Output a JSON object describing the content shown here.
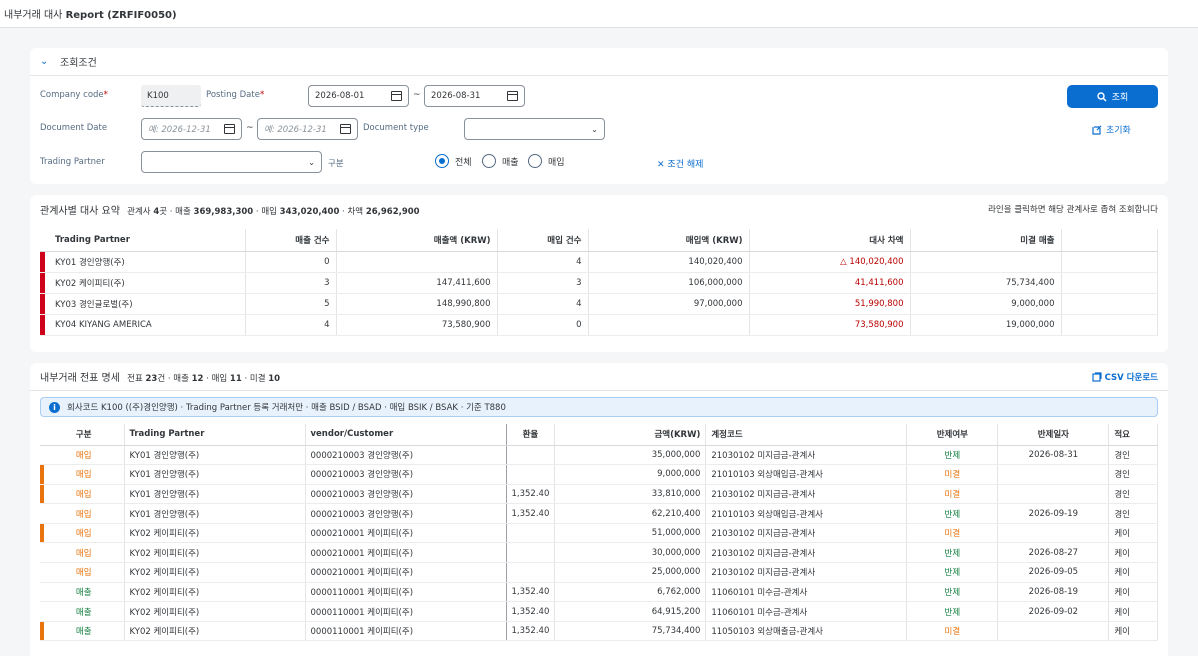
{
  "app": {
    "title_plain": "내부거래 대사",
    "title_bold": "Report (ZRFIF0050)"
  },
  "criteria": {
    "header": "조회조건",
    "company_code_label": "Company code",
    "company_code_value": "K100",
    "posting_date_label": "Posting Date",
    "posting_from": "2026-08-01",
    "posting_to": "2026-08-31",
    "document_date_label": "Document Date",
    "doc_from_ph": "예: 2026-12-31",
    "doc_to_ph": "예: 2026-12-31",
    "document_type_label": "Document type",
    "trading_partner_label": "Trading Partner",
    "division_label": "구분",
    "radio_all": "전체",
    "radio_sales": "매출",
    "radio_purchase": "매입",
    "clear_label": "조건 해제",
    "search_label": "조회",
    "reset_label": "초기화",
    "tilde": "~",
    "req": "*"
  },
  "summary": {
    "title": "관계사별 대사 요약",
    "meta_parts": [
      "관계사 ",
      "4",
      "곳 · 매출 ",
      "369,983,300",
      " · 매입 ",
      "343,020,400",
      " · 차액 ",
      "26,962,900"
    ],
    "hint": "라인을 클릭하면 해당 관계사로 좁혀 조회합니다",
    "columns": [
      "Trading Partner",
      "매출 건수",
      "매출액 (KRW)",
      "매입 건수",
      "매입액 (KRW)",
      "대사 차액",
      "미결 매출"
    ],
    "rows": [
      {
        "partner": "KY01 경인양행(주)",
        "sales_cnt": "0",
        "sales_amt": "",
        "pur_cnt": "4",
        "pur_amt": "140,020,400",
        "diff": "△ 140,020,400",
        "open": ""
      },
      {
        "partner": "KY02 케이피티(주)",
        "sales_cnt": "3",
        "sales_amt": "147,411,600",
        "pur_cnt": "3",
        "pur_amt": "106,000,000",
        "diff": "41,411,600",
        "open": "75,734,400"
      },
      {
        "partner": "KY03 경인글로벌(주)",
        "sales_cnt": "5",
        "sales_amt": "148,990,800",
        "pur_cnt": "4",
        "pur_amt": "97,000,000",
        "diff": "51,990,800",
        "open": "9,000,000"
      },
      {
        "partner": "KY04 KIYANG AMERICA",
        "sales_cnt": "4",
        "sales_amt": "73,580,900",
        "pur_cnt": "0",
        "pur_amt": "",
        "diff": "73,580,900",
        "open": "19,000,000"
      }
    ]
  },
  "details": {
    "title": "내부거래 전표 명세",
    "meta_parts": [
      "전표 ",
      "23",
      "건 · 매출 ",
      "12",
      " · 매입 ",
      "11",
      " · 미결 ",
      "10"
    ],
    "csv_label": "CSV 다운로드",
    "info": "회사코드 K100 ((주)경인양행) · Trading Partner 등록 거래처만 · 매출 BSID / BSAD · 매입 BSIK / BSAK · 기준 T880",
    "columns": [
      "구분",
      "Trading Partner",
      "vendor/Customer",
      "환율",
      "금액(KRW)",
      "계정코드",
      "반제여부",
      "반제일자",
      "적요"
    ],
    "rows": [
      {
        "flag": false,
        "type": "매입",
        "partner": "KY01 경인양행(주)",
        "vc": "0000210003 경인양행(주)",
        "rate": "",
        "amt": "35,000,000",
        "acct": "21030102 미지급금-관계사",
        "cleared": "반제",
        "cdate": "2026-08-31",
        "memo": "경인"
      },
      {
        "flag": true,
        "type": "매입",
        "partner": "KY01 경인양행(주)",
        "vc": "0000210003 경인양행(주)",
        "rate": "",
        "amt": "9,000,000",
        "acct": "21010103 외상매입금-관계사",
        "cleared": "미결",
        "cdate": "",
        "memo": "경인"
      },
      {
        "flag": true,
        "type": "매입",
        "partner": "KY01 경인양행(주)",
        "vc": "0000210003 경인양행(주)",
        "rate": "1,352.40",
        "amt": "33,810,000",
        "acct": "21030102 미지급금-관계사",
        "cleared": "미결",
        "cdate": "",
        "memo": "경인"
      },
      {
        "flag": false,
        "type": "매입",
        "partner": "KY01 경인양행(주)",
        "vc": "0000210003 경인양행(주)",
        "rate": "1,352.40",
        "amt": "62,210,400",
        "acct": "21010103 외상매입금-관계사",
        "cleared": "반제",
        "cdate": "2026-09-19",
        "memo": "경인"
      },
      {
        "flag": true,
        "type": "매입",
        "partner": "KY02 케이피티(주)",
        "vc": "0000210001 케이피티(주)",
        "rate": "",
        "amt": "51,000,000",
        "acct": "21030102 미지급금-관계사",
        "cleared": "미결",
        "cdate": "",
        "memo": "케이"
      },
      {
        "flag": false,
        "type": "매입",
        "partner": "KY02 케이피티(주)",
        "vc": "0000210001 케이피티(주)",
        "rate": "",
        "amt": "30,000,000",
        "acct": "21030102 미지급금-관계사",
        "cleared": "반제",
        "cdate": "2026-08-27",
        "memo": "케이"
      },
      {
        "flag": false,
        "type": "매입",
        "partner": "KY02 케이피티(주)",
        "vc": "0000210001 케이피티(주)",
        "rate": "",
        "amt": "25,000,000",
        "acct": "21030102 미지급금-관계사",
        "cleared": "반제",
        "cdate": "2026-09-05",
        "memo": "케이"
      },
      {
        "flag": false,
        "type": "매출",
        "partner": "KY02 케이피티(주)",
        "vc": "0000110001 케이피티(주)",
        "rate": "1,352.40",
        "amt": "6,762,000",
        "acct": "11060101 미수금-관계사",
        "cleared": "반제",
        "cdate": "2026-08-19",
        "memo": "케이"
      },
      {
        "flag": false,
        "type": "매출",
        "partner": "KY02 케이피티(주)",
        "vc": "0000110001 케이피티(주)",
        "rate": "1,352.40",
        "amt": "64,915,200",
        "acct": "11060101 미수금-관계사",
        "cleared": "반제",
        "cdate": "2026-09-02",
        "memo": "케이"
      },
      {
        "flag": true,
        "type": "매출",
        "partner": "KY02 케이피티(주)",
        "vc": "0000110001 케이피티(주)",
        "rate": "1,352.40",
        "amt": "75,734,400",
        "acct": "11050103 외상매출금-관계사",
        "cleared": "미결",
        "cdate": "",
        "memo": "케이"
      }
    ]
  },
  "colors": {
    "accent": "#0a6ed1",
    "marker_red": "#d0021b",
    "marker_orange": "#e9730c",
    "negative": "#bb0000",
    "cleared": "#107e3e",
    "open": "#e9730c",
    "purchase": "#e9730c",
    "sales": "#107e3e"
  },
  "icons": {
    "chevron": "chevron-down-icon",
    "calendar": "calendar-icon",
    "search": "search-icon",
    "reset": "reset-icon",
    "close": "close-icon",
    "info": "info-icon",
    "csv": "csv-icon"
  }
}
